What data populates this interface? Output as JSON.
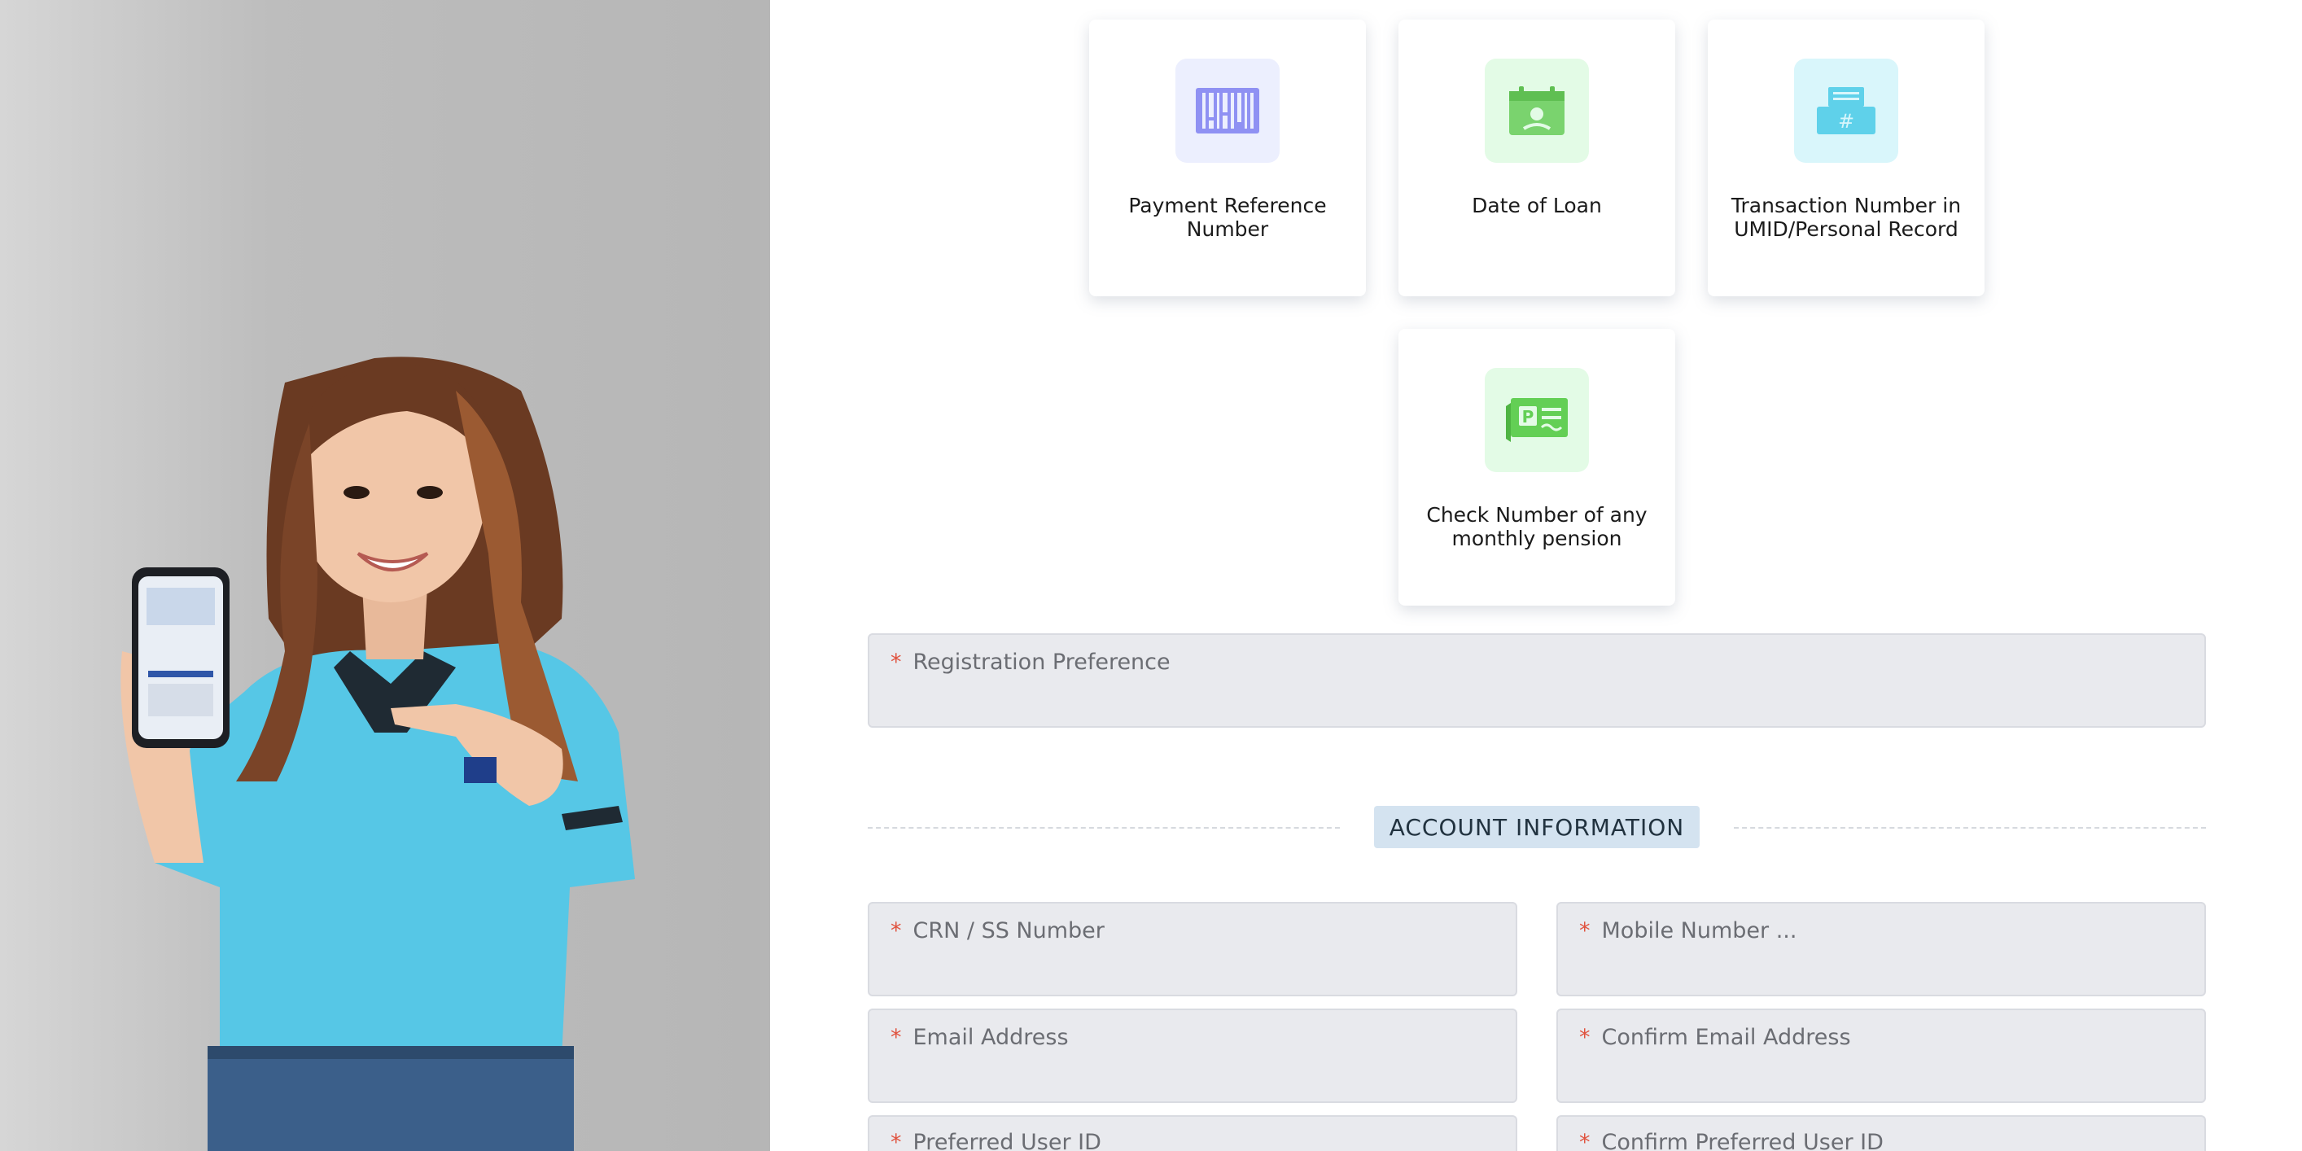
{
  "verification_options": [
    {
      "label": "Payment Reference Number",
      "icon": "barcode-icon",
      "icon_bg": "#eceffe",
      "icon_color": "#8f91f3"
    },
    {
      "label": "Date of Loan",
      "icon": "calendar-loan-icon",
      "icon_bg": "#e3fbe6",
      "icon_color": "#7ad36e"
    },
    {
      "label": "Transaction Number in UMID/Personal Record",
      "icon": "umid-card-icon",
      "icon_bg": "#d9f6fb",
      "icon_color": "#5fd1ea"
    },
    {
      "label": "Check Number of any monthly pension",
      "icon": "pension-check-icon",
      "icon_bg": "#e3fbe6",
      "icon_color": "#63cf55"
    }
  ],
  "registration_preference": {
    "label": "Registration Preference",
    "required": "*"
  },
  "account_information": {
    "title": "ACCOUNT INFORMATION",
    "fields": {
      "crn": {
        "label": "CRN / SS Number",
        "required": "*"
      },
      "mobile": {
        "label": "Mobile Number ...",
        "required": "*"
      },
      "email": {
        "label": "Email Address",
        "required": "*"
      },
      "confirm_email": {
        "label": "Confirm Email Address",
        "required": "*"
      },
      "user_id": {
        "label": "Preferred User ID",
        "required": "*"
      },
      "confirm_user_id": {
        "label": "Confirm Preferred User ID",
        "required": "*"
      }
    }
  },
  "colors": {
    "accent_required": "#e0533f",
    "field_bg": "#e9eaee",
    "section_title_bg": "#d4e3f0",
    "shirt": "#56c7e6"
  }
}
